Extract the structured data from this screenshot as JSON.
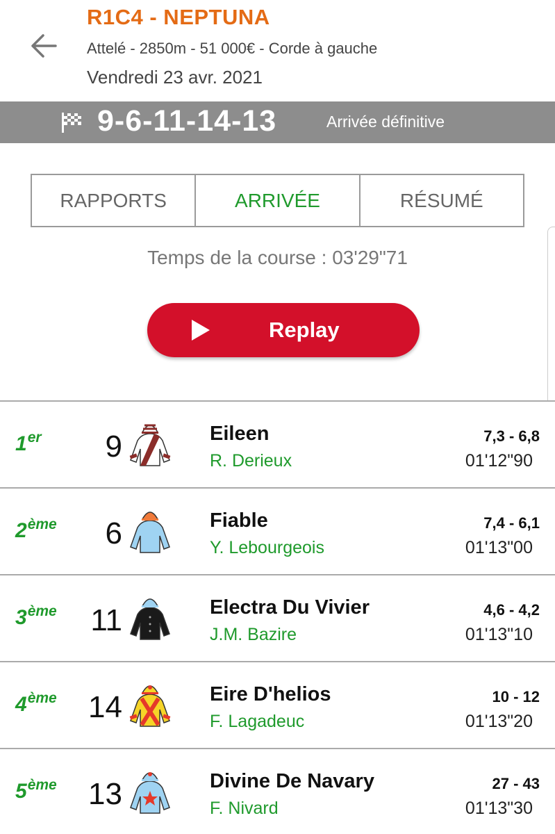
{
  "header": {
    "title": "R1C4 - NEPTUNA",
    "info": "Attelé - 2850m - 51 000€  - Corde à gauche",
    "date": "Vendredi 23 avr. 2021"
  },
  "result_bar": {
    "numbers": "9-6-11-14-13",
    "status": "Arrivée définitive"
  },
  "tabs": [
    {
      "label": "RAPPORTS",
      "active": false
    },
    {
      "label": "ARRIVÉE",
      "active": true
    },
    {
      "label": "RÉSUMÉ",
      "active": false
    }
  ],
  "race_time": "Temps de la course : 03'29\"71",
  "replay_label": "Replay",
  "colors": {
    "accent_orange": "#e46b15",
    "green": "#1f9a2c",
    "replay_red": "#d3102a",
    "bar_gray": "#8d8d8d"
  },
  "results": [
    {
      "rank": "1",
      "rank_suffix": "er",
      "number": "9",
      "horse": "Eileen",
      "driver": "R. Derieux",
      "odds": "7,3 - 6,8",
      "time": "01'12\"90",
      "silk": "white-brown-sash-icon"
    },
    {
      "rank": "2",
      "rank_suffix": "ème",
      "number": "6",
      "horse": "Fiable",
      "driver": "Y. Lebourgeois",
      "odds": "7,4 - 6,1",
      "time": "01'13\"00",
      "silk": "light-blue-orange-cap-icon"
    },
    {
      "rank": "3",
      "rank_suffix": "ème",
      "number": "11",
      "horse": "Electra Du Vivier",
      "driver": "J.M. Bazire",
      "odds": "4,6 - 4,2",
      "time": "01'13\"10",
      "silk": "black-blue-cap-icon"
    },
    {
      "rank": "4",
      "rank_suffix": "ème",
      "number": "14",
      "horse": "Eire D'helios",
      "driver": "F. Lagadeuc",
      "odds": "10 - 12",
      "time": "01'13\"20",
      "silk": "yellow-red-cross-icon"
    },
    {
      "rank": "5",
      "rank_suffix": "ème",
      "number": "13",
      "horse": "Divine De Navary",
      "driver": "F. Nivard",
      "odds": "27 - 43",
      "time": "01'13\"30",
      "silk": "light-blue-red-star-icon"
    }
  ]
}
